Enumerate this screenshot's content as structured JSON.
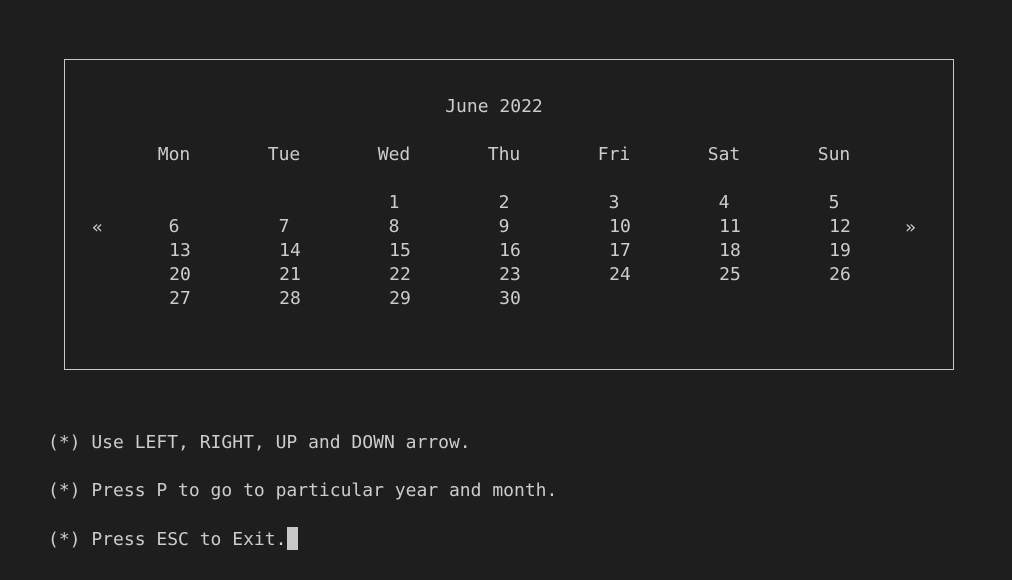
{
  "calendar": {
    "title": "June 2022",
    "prev_arrow": "«",
    "next_arrow": "»",
    "weekdays": [
      "Mon",
      "Tue",
      "Wed",
      "Thu",
      "Fri",
      "Sat",
      "Sun"
    ],
    "weeks": [
      [
        "",
        "",
        "1",
        "2",
        "3",
        "4",
        "5"
      ],
      [
        "6",
        "7",
        "8",
        "9",
        "10",
        "11",
        "12"
      ],
      [
        "13",
        "14",
        "15",
        "16",
        "17",
        "18",
        "19"
      ],
      [
        "20",
        "21",
        "22",
        "23",
        "24",
        "25",
        "26"
      ],
      [
        "27",
        "28",
        "29",
        "30",
        "",
        "",
        ""
      ]
    ]
  },
  "instructions": {
    "line1": "(*) Use LEFT, RIGHT, UP and DOWN arrow.",
    "line2": "(*) Press P to go to particular year and month.",
    "line3": "(*) Press ESC to Exit."
  }
}
